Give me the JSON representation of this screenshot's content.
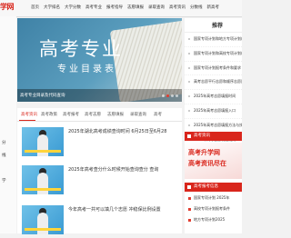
{
  "site": {
    "logo": "学网"
  },
  "nav": [
    "首页",
    "大学排名",
    "大学分数",
    "高考专业",
    "报考指导",
    "志愿填报",
    "录取查询",
    "高考资讯",
    "分数线",
    "新高考"
  ],
  "left_strip": [
    "分",
    "线",
    "学"
  ],
  "banner": {
    "title": "高考专业",
    "subtitle": "专业目录表",
    "caption": "高考专业目录及代码查询",
    "active_dot": 1
  },
  "recommend": {
    "heading": "推荐",
    "items": [
      "国家专项计划和地方专项计划的",
      "国家专项计划和高校专项计划的",
      "国家专项计划报考条件和要求",
      "高考志愿平行志愿和顺序志愿区",
      "2025年高考志愿填报时间",
      "2025年高考志愿填报入口",
      "2025年高考志愿填报方法与技",
      "2025年高考志愿填报规则"
    ]
  },
  "ad": {
    "line1": "高考升学网",
    "line2": "高考资讯尽在"
  },
  "side_sections": [
    {
      "label": "高考资讯"
    },
    {
      "label": "高考报考信息"
    }
  ],
  "side_small": [
    "国家专项计划 2025年",
    "高校专项计划报考条件",
    "地方专项计划2025"
  ],
  "tabs": [
    "高考资讯",
    "高考政策",
    "高考报考",
    "高考志愿",
    "志愿填报",
    "录取查询",
    "高考"
  ],
  "articles": [
    {
      "title": "2025年湖北高考成绩查询时间 6月25日至6月28"
    },
    {
      "title": "2025年高考查分什么时候开始查询查分 查询"
    },
    {
      "title": "今年高考一共可以填几个志愿 冲稳保比例设置"
    }
  ]
}
